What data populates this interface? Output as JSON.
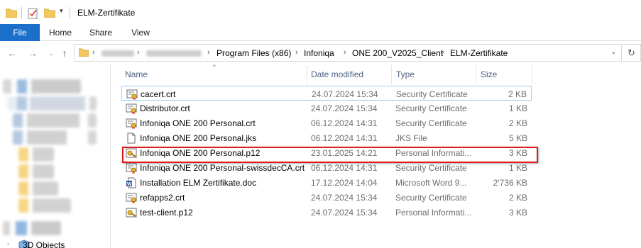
{
  "window": {
    "title": "ELM-Zertifikate"
  },
  "ribbon": {
    "tabs": [
      "File",
      "Home",
      "Share",
      "View"
    ]
  },
  "address": {
    "crumbs": [
      "Program Files (x86)",
      "Infoniqa",
      "ONE 200_V2025_Client",
      "ELM-Zertifikate"
    ]
  },
  "navpane": {
    "visible_label": "3D Objects"
  },
  "columns": {
    "name": "Name",
    "date": "Date modified",
    "type": "Type",
    "size": "Size"
  },
  "files": [
    {
      "name": "cacert.crt",
      "date": "24.07.2024 15:34",
      "type": "Security Certificate",
      "size": "2 KB",
      "icon": "certificate-icon"
    },
    {
      "name": "Distributor.crt",
      "date": "24.07.2024 15:34",
      "type": "Security Certificate",
      "size": "1 KB",
      "icon": "certificate-icon"
    },
    {
      "name": "Infoniqa ONE 200 Personal.crt",
      "date": "06.12.2024 14:31",
      "type": "Security Certificate",
      "size": "2 KB",
      "icon": "certificate-icon"
    },
    {
      "name": "Infoniqa ONE 200 Personal.jks",
      "date": "06.12.2024 14:31",
      "type": "JKS File",
      "size": "5 KB",
      "icon": "blank-file-icon"
    },
    {
      "name": "Infoniqa ONE 200 Personal.p12",
      "date": "23.01.2025 14:21",
      "type": "Personal Informati...",
      "size": "3 KB",
      "icon": "personal-cert-icon"
    },
    {
      "name": "Infoniqa ONE 200 Personal-swissdecCA.crt",
      "date": "06.12.2024 14:31",
      "type": "Security Certificate",
      "size": "1 KB",
      "icon": "certificate-icon"
    },
    {
      "name": "Installation ELM Zertifikate.doc",
      "date": "17.12.2024 14:04",
      "type": "Microsoft Word 9...",
      "size": "2'736 KB",
      "icon": "word-doc-icon"
    },
    {
      "name": "refapps2.crt",
      "date": "24.07.2024 15:34",
      "type": "Security Certificate",
      "size": "2 KB",
      "icon": "certificate-icon"
    },
    {
      "name": "test-client.p12",
      "date": "24.07.2024 15:34",
      "type": "Personal Informati...",
      "size": "3 KB",
      "icon": "personal-cert-icon"
    }
  ],
  "highlighted_file_index": 4,
  "colors": {
    "accent": "#1a6fc9",
    "highlight_box": "#e11a1a",
    "selection_border": "#99d1ff"
  }
}
